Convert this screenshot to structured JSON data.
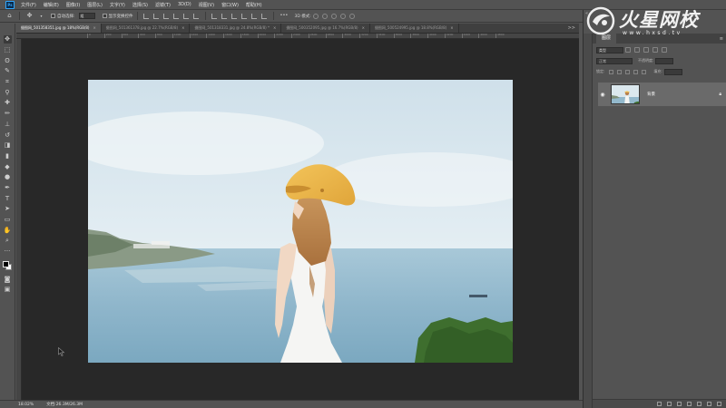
{
  "app": {
    "logo_text": "Ps",
    "menu": [
      "文件(F)",
      "编辑(E)",
      "图像(I)",
      "图层(L)",
      "文字(Y)",
      "选择(S)",
      "滤镜(T)",
      "3D(D)",
      "视图(V)",
      "窗口(W)",
      "帮助(H)"
    ]
  },
  "options_bar": {
    "auto_select_label": "自动选择:",
    "auto_select_value": "组",
    "show_transform_label": "显示变换控件",
    "mode_3d_label": "3D 模式:"
  },
  "tabs": [
    {
      "label": "摄图网_501358351.jpg @ 18%(RGB/8)",
      "active": true
    },
    {
      "label": "摄图网_501361378.jpg @ 22.7%(RGB/8)",
      "active": false
    },
    {
      "label": "摄图网_501318331.jpg @ 24.8%(RGB/8) *",
      "active": false
    },
    {
      "label": "摄图网_500352095.jpg @ 16.7%(RGB/8)",
      "active": false
    },
    {
      "label": "摄图网_500524995.jpg @ 18.8%(RGB/8)",
      "active": false
    }
  ],
  "tab_overflow": ">>",
  "ruler_ticks": [
    "0",
    "200",
    "400",
    "600",
    "800",
    "1000",
    "1200",
    "1400",
    "1600",
    "1800",
    "2000",
    "2200",
    "2400",
    "2600",
    "2800",
    "3000",
    "3200",
    "3400",
    "3600",
    "3800",
    "4000",
    "4200",
    "4400",
    "4600",
    "4800"
  ],
  "tools": [
    {
      "name": "move-tool",
      "glyph": "✥"
    },
    {
      "name": "marquee-tool",
      "glyph": "⬚"
    },
    {
      "name": "lasso-tool",
      "glyph": "ʘ"
    },
    {
      "name": "quick-select-tool",
      "glyph": "✎"
    },
    {
      "name": "crop-tool",
      "glyph": "⌗"
    },
    {
      "name": "eyedropper-tool",
      "glyph": "⚲"
    },
    {
      "name": "healing-brush-tool",
      "glyph": "✚"
    },
    {
      "name": "brush-tool",
      "glyph": "✏"
    },
    {
      "name": "clone-stamp-tool",
      "glyph": "⊥"
    },
    {
      "name": "history-brush-tool",
      "glyph": "↺"
    },
    {
      "name": "eraser-tool",
      "glyph": "◨"
    },
    {
      "name": "gradient-tool",
      "glyph": "▮"
    },
    {
      "name": "blur-tool",
      "glyph": "◆"
    },
    {
      "name": "dodge-tool",
      "glyph": "●"
    },
    {
      "name": "pen-tool",
      "glyph": "✒"
    },
    {
      "name": "type-tool",
      "glyph": "T"
    },
    {
      "name": "path-select-tool",
      "glyph": "➤"
    },
    {
      "name": "shape-tool",
      "glyph": "▭"
    },
    {
      "name": "hand-tool",
      "glyph": "✋"
    },
    {
      "name": "zoom-tool",
      "glyph": "⌕"
    },
    {
      "name": "edit-toolbar",
      "glyph": "···"
    }
  ],
  "extra_tools": [
    {
      "name": "quick-mask-button",
      "glyph": "◙"
    },
    {
      "name": "screen-mode-button",
      "glyph": "▣"
    }
  ],
  "status": {
    "zoom": "18.02%",
    "doc": "文档:26.3M/26.3M"
  },
  "layers_panel": {
    "tab_label": "图层",
    "kind_label": "类型",
    "blend_mode": "正常",
    "opacity_label": "不透明度:",
    "lock_label": "锁定:",
    "fill_label": "填充:",
    "layer_name": "背景"
  },
  "watermark": {
    "title": "火星网校",
    "url": "www.hxsd.tv"
  },
  "colors": {
    "ui_bg": "#535353",
    "workspace": "#282828",
    "fg_color": "#000000",
    "bg_color": "#ffffff"
  }
}
